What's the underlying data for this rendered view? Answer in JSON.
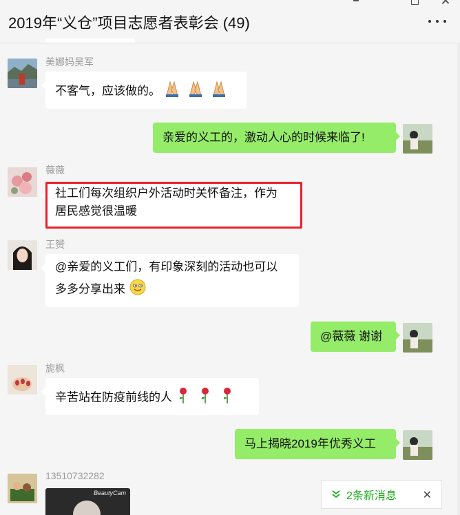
{
  "window": {
    "title": "2019年“义仓”项目志愿者表彰会 (49)",
    "more_icon": "more-horizontal-icon",
    "controls": [
      "pin-icon",
      "maximize-icon",
      "close-icon"
    ]
  },
  "messages": [
    {
      "side": "left",
      "sender": "美娜妈吴军",
      "text": "不客气，应该做的。",
      "emoji": "pray-hands-x3"
    },
    {
      "side": "right",
      "text": "亲爱的义工的，激动人心的时候来临了!"
    },
    {
      "side": "left",
      "sender": "薇薇",
      "lines": [
        "社工们每次组织户外活动时关怀备注，作为",
        "居民感觉很温暖"
      ],
      "highlight": true,
      "highlight_color": "#e8202a"
    },
    {
      "side": "left",
      "sender": "王赟",
      "lines": [
        "@亲爱的义工们，有印象深刻的活动也可以",
        "多多分享出来"
      ],
      "emoji": "smile"
    },
    {
      "side": "right",
      "text": "@薇薇 谢谢"
    },
    {
      "side": "left",
      "sender": "旎枫",
      "text": "辛苦站在防疫前线的人",
      "emoji": "rose-x3"
    },
    {
      "side": "right",
      "text": "马上揭晓2019年优秀义工"
    },
    {
      "side": "left",
      "sender": "13510732282",
      "image_caption": "BeautyCam",
      "type": "image"
    }
  ],
  "new_message_bar": {
    "label": "2条新消息",
    "close_label": "✕",
    "icon": "double-chevron-down-icon"
  },
  "colors": {
    "right_bubble": "#95ec69",
    "left_bubble": "#ffffff",
    "accent": "#1aad19",
    "background": "#f5f5f5"
  }
}
